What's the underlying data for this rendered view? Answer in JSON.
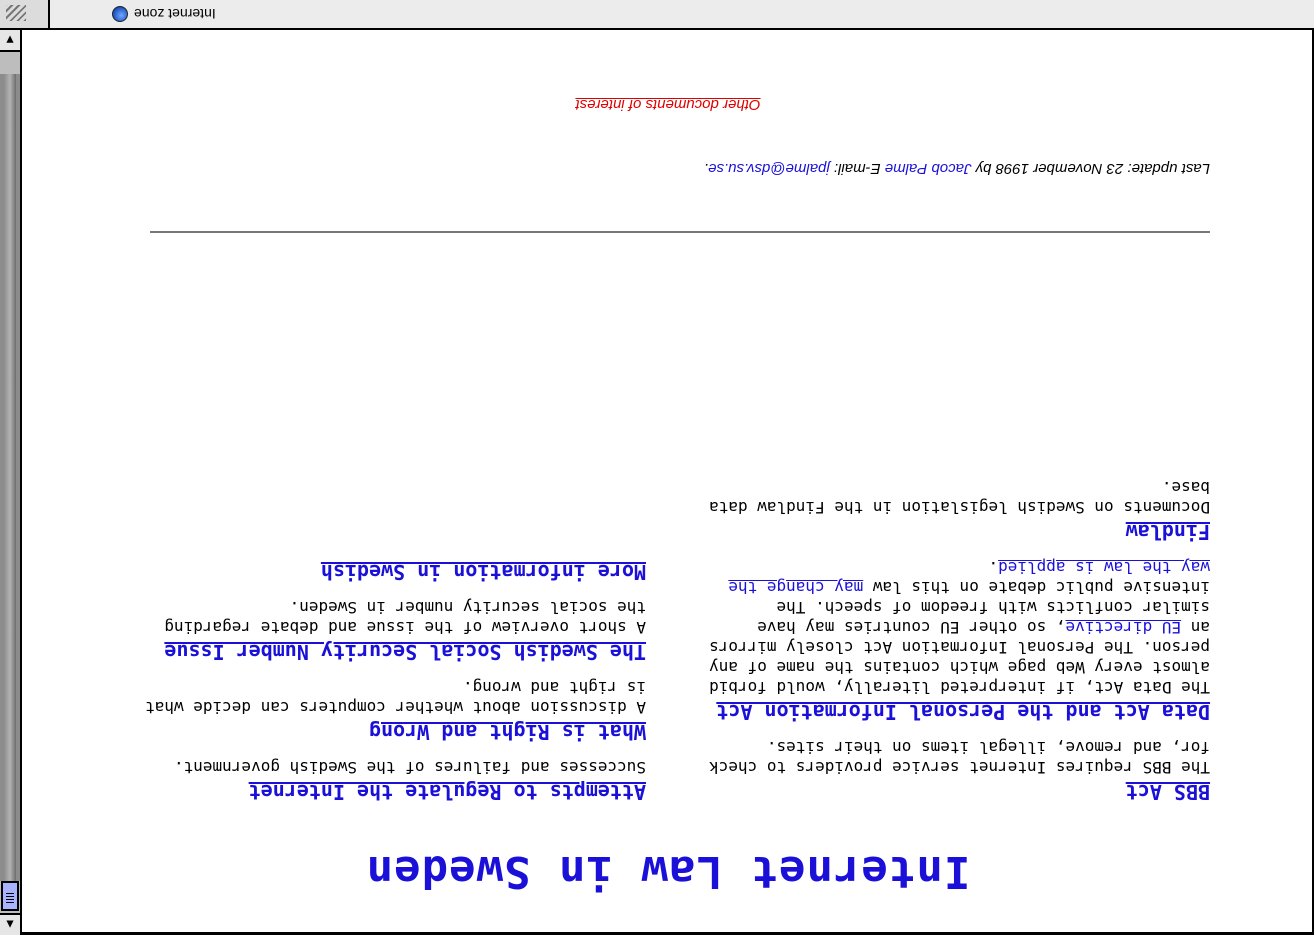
{
  "status": {
    "zone": "Internet zone"
  },
  "page": {
    "title": "Internet Law in Sweden",
    "left": [
      {
        "heading": "BBS Act",
        "text": "The BBS requires Internet service providers to check for, and remove, illegal items on their sites."
      },
      {
        "heading": "Data Act and the Personal Information Act",
        "text1": "The Data Act, if interpreted literally, would forbid almost every Web page which contains the name of any person. The Personal Information Act closely mirrors an ",
        "link1": "EU directive",
        "text2": ", so other EU countries may have similar conflicts with freedom of speech. The intensive public debate on this law ",
        "link2": "may change the way the law is applied",
        "text3": "."
      },
      {
        "heading": "Findlaw",
        "text": "Documents on Swedish legislation in the Findlaw data base."
      }
    ],
    "right": [
      {
        "heading": "Attempts to Regulate the Internet",
        "text": "Successes and failures of the Swedish government."
      },
      {
        "heading": "What is Right and Wrong",
        "text": "A discussion about whether computers can decide what is right and wrong."
      },
      {
        "heading": "The Swedish Social Security Number Issue",
        "text": "A short overview of the issue and debate regarding the social security number in Sweden."
      },
      {
        "heading": "More information in Swedish",
        "text": ""
      }
    ],
    "update_prefix": "Last update: 23 November 1998 by ",
    "author": "Jacob Palme",
    "email_prefix": " E-mail: ",
    "email": "jpalme@dsv.su.se",
    "email_suffix": ".",
    "other_link": "Other documents of interest"
  }
}
